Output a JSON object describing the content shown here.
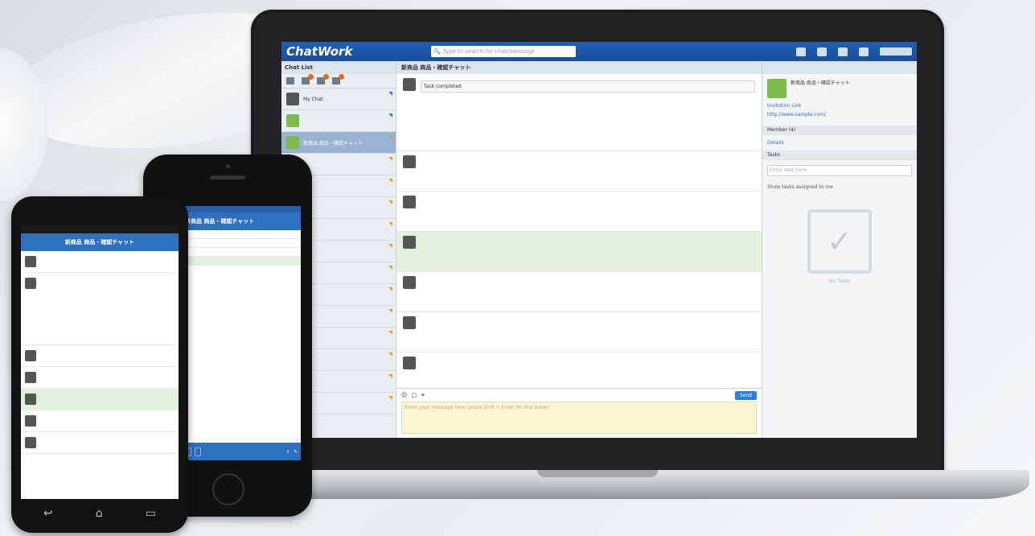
{
  "laptop": {
    "brand": "ChatWork",
    "search_placeholder": "Type to search for chat/message",
    "sidebar": {
      "title": "Chat List",
      "rooms": [
        {
          "name": "My Chat",
          "active": false
        },
        {
          "name": "",
          "active": false
        },
        {
          "name": "新商品 商品・確認チャット",
          "active": true
        },
        {
          "name": "",
          "active": false
        },
        {
          "name": "",
          "active": false
        },
        {
          "name": "",
          "active": false
        },
        {
          "name": "",
          "active": false
        },
        {
          "name": "",
          "active": false
        },
        {
          "name": "",
          "active": false
        },
        {
          "name": "",
          "active": false
        },
        {
          "name": "",
          "active": false
        },
        {
          "name": "",
          "active": false
        },
        {
          "name": "",
          "active": false
        },
        {
          "name": "",
          "active": false
        },
        {
          "name": "",
          "active": false
        }
      ]
    },
    "chat": {
      "title": "新商品 商品・確認チャット",
      "messages": [
        {
          "text": "Task completed",
          "highlight": false
        },
        {
          "text": "",
          "highlight": false
        },
        {
          "text": "",
          "highlight": false
        },
        {
          "text": "",
          "highlight": true
        },
        {
          "text": "",
          "highlight": false
        },
        {
          "text": "",
          "highlight": false
        },
        {
          "text": "",
          "highlight": false
        }
      ],
      "composer_placeholder": "Enter your message here (press Shift + Enter for line break)",
      "send_label": "Send"
    },
    "right_panel": {
      "room_name": "新商品 商品・確認チャット",
      "invitation_link": "Invitation Link",
      "url": "http://www.sample.com/",
      "member_section": "Member (4)",
      "details": "Details",
      "tasks_section": "Tasks",
      "task_placeholder": "Enter task here",
      "show_tasks": "Show tasks assigned to me",
      "no_tasks": "No Tasks"
    }
  },
  "iphone": {
    "title": "新商品 商品・確認チャット"
  },
  "android": {
    "title": "新商品 商品・確認チャット"
  }
}
